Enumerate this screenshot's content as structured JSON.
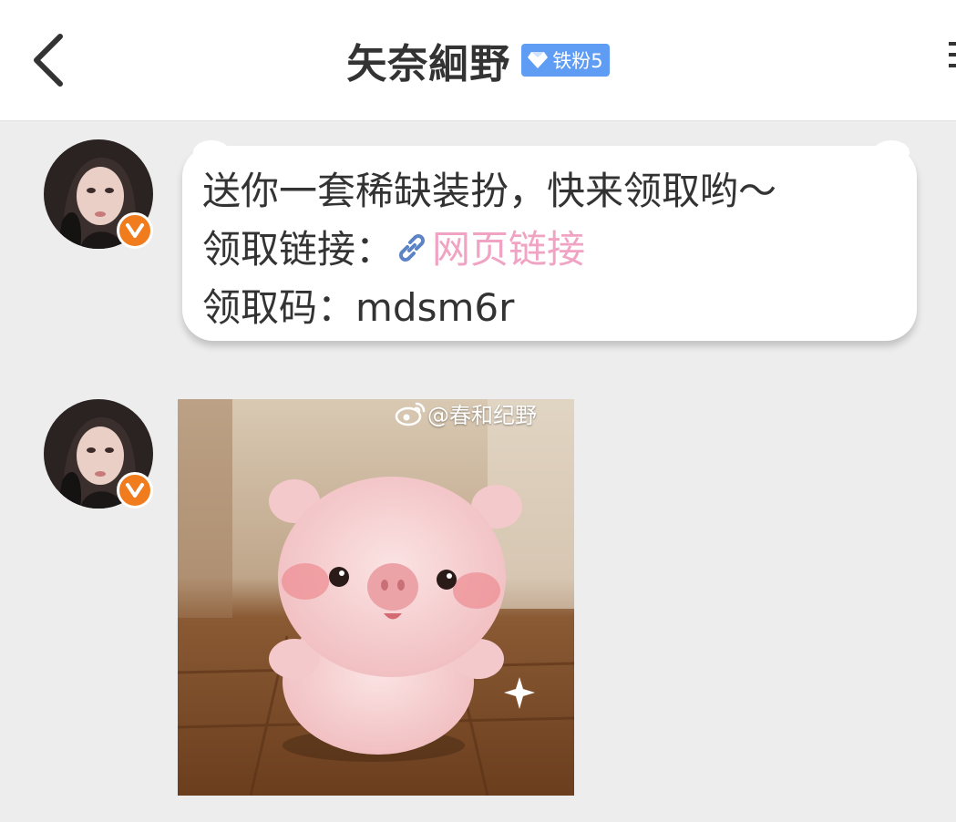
{
  "header": {
    "title": "矢奈絗野",
    "fan_badge": "铁粉5",
    "back_icon": "chevron-left-icon",
    "colors": {
      "fan_badge": "#5f9df5",
      "verified": "#f07c1e",
      "link": "#f0a3c3"
    }
  },
  "messages": [
    {
      "type": "text",
      "lines": {
        "line1": "送你一套稀缺装扮，快来领取哟～",
        "line2_label": "领取链接：",
        "line2_link": "网页链接",
        "line3": "领取码：mdsm6r"
      }
    },
    {
      "type": "image",
      "watermark": "@春和纪野",
      "description_icon": "weibo-logo-icon"
    }
  ]
}
